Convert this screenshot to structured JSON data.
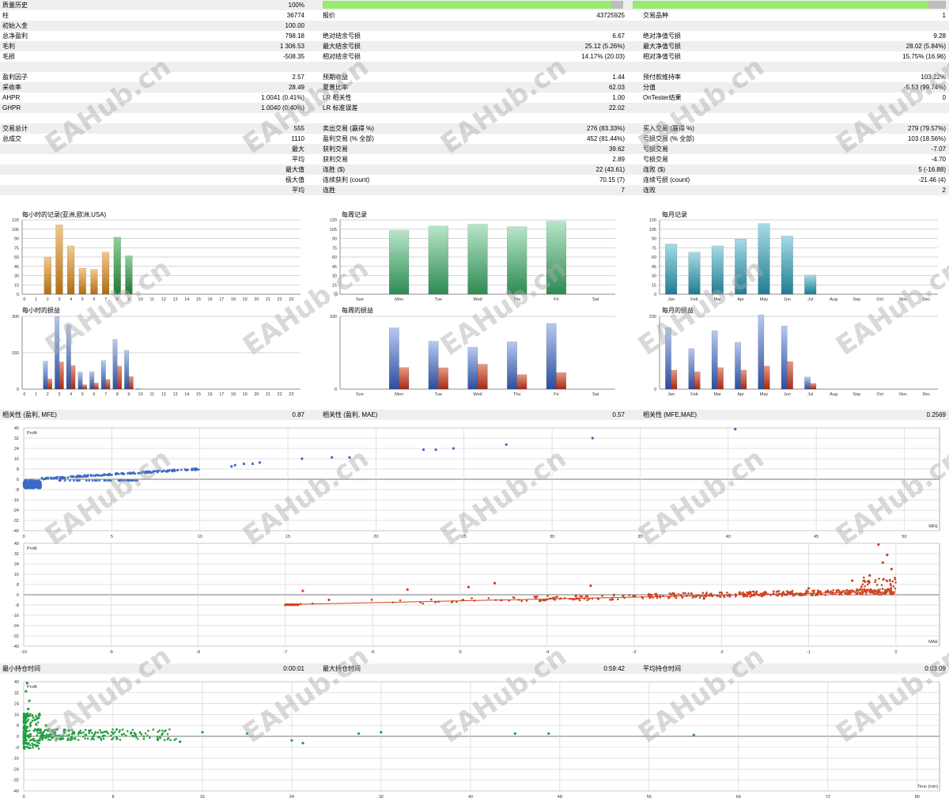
{
  "stats": {
    "history_quality": {
      "label": "质量历史",
      "value": "100%",
      "percent": 100
    },
    "bars": {
      "label": "柱",
      "value": "36774"
    },
    "ticks": {
      "label": "报价",
      "value": "43725925"
    },
    "symbols": {
      "label": "交易品种",
      "value": "1"
    },
    "initial_deposit": {
      "label": "初始入金",
      "value": "100.00"
    },
    "net_profit": {
      "label": "总净盈利",
      "value": "798.18"
    },
    "balance_dd_abs": {
      "label": "绝对结余亏损",
      "value": "6.67"
    },
    "equity_dd_abs": {
      "label": "绝对净值亏损",
      "value": "9.28"
    },
    "gross_profit": {
      "label": "毛利",
      "value": "1 306.53"
    },
    "balance_dd_max": {
      "label": "最大结余亏损",
      "value": "25.12 (5.26%)"
    },
    "equity_dd_max": {
      "label": "最大净值亏损",
      "value": "28.02 (5.84%)"
    },
    "gross_loss": {
      "label": "毛损",
      "value": "-508.35"
    },
    "balance_dd_rel": {
      "label": "相对结余亏损",
      "value": "14.17% (20.03)"
    },
    "equity_dd_rel": {
      "label": "相对净值亏损",
      "value": "15.75% (16.96)"
    },
    "profit_factor": {
      "label": "盈利因子",
      "value": "2.57"
    },
    "expected_payoff": {
      "label": "预期收益",
      "value": "1.44"
    },
    "margin_level": {
      "label": "预付款维持率",
      "value": "103.22%"
    },
    "recovery_factor": {
      "label": "采收率",
      "value": "28.49"
    },
    "sharpe_ratio": {
      "label": "夏普比率",
      "value": "62.03"
    },
    "z_score": {
      "label": "分值",
      "value": "-5.53 (99.74%)"
    },
    "ahpr": {
      "label": "AHPR",
      "value": "1.0041 (0.41%)"
    },
    "lr_correlation": {
      "label": "LR 相关性",
      "value": "1.00"
    },
    "ontester_result": {
      "label": "OnTester结果",
      "value": "0"
    },
    "ghpr": {
      "label": "GHPR",
      "value": "1.0040 (0.40%)"
    },
    "lr_std_error": {
      "label": "LR 标准误差",
      "value": "22.02"
    },
    "total_trades": {
      "label": "交易总计",
      "value": "555"
    },
    "short_trades": {
      "label": "卖出交易 (赢得 %)",
      "value": "276 (83.33%)"
    },
    "long_trades": {
      "label": "买入交易 (赢得 %)",
      "value": "279 (79.57%)"
    },
    "total_deals": {
      "label": "总成交",
      "value": "1110"
    },
    "profit_trades": {
      "label": "盈利交易 (% 全部)",
      "value": "452 (81.44%)"
    },
    "loss_trades": {
      "label": "亏损交易 (% 全部)",
      "value": "103 (18.56%)"
    },
    "largest_label": "最大",
    "largest_profit": {
      "label": "获利交易",
      "value": "39.62"
    },
    "largest_loss": {
      "label": "亏损交易",
      "value": "-7.07"
    },
    "average_label": "平均",
    "average_profit": {
      "label": "获利交易",
      "value": "2.89"
    },
    "average_loss": {
      "label": "亏损交易",
      "value": "-4.70"
    },
    "maximum_label": "最大值",
    "max_consec_wins": {
      "label": "连胜 ($)",
      "value": "22 (43.61)"
    },
    "max_consec_losses": {
      "label": "连败 ($)",
      "value": "5 (-16.88)"
    },
    "maximal_label": "极大值",
    "maximal_consec_profit": {
      "label": "连续获利 (count)",
      "value": "70.15 (7)"
    },
    "maximal_consec_loss": {
      "label": "连续亏损 (count)",
      "value": "-21.46 (4)"
    },
    "avg_label": "平均",
    "avg_consec_wins": {
      "label": "连胜",
      "value": "7"
    },
    "avg_consec_losses": {
      "label": "连败",
      "value": "2"
    },
    "corr_profit_mfe": {
      "label": "相关性 (盈利, MFE)",
      "value": "0.87"
    },
    "corr_profit_mae": {
      "label": "相关性 (盈利, MAE)",
      "value": "0.57"
    },
    "corr_mfe_mae": {
      "label": "相关性 (MFE,MAE)",
      "value": "0.2569"
    },
    "min_holding": {
      "label": "最小持仓时间",
      "value": "0:00:01"
    },
    "max_holding": {
      "label": "最大持仓时间",
      "value": "0:59:42"
    },
    "avg_holding": {
      "label": "平均持仓时间",
      "value": "0:03:09"
    }
  },
  "watermark_text": "EAHub.cn",
  "chart_data": [
    {
      "id": "hourly_entries",
      "type": "bar",
      "title": "每小时的记录(亚洲,欧洲,USA)",
      "categories": [
        "0",
        "1",
        "2",
        "3",
        "4",
        "5",
        "6",
        "7",
        "8",
        "9",
        "10",
        "11",
        "12",
        "13",
        "14",
        "15",
        "16",
        "17",
        "18",
        "19",
        "20",
        "21",
        "22",
        "23"
      ],
      "values": [
        0,
        0,
        60,
        112,
        78,
        42,
        40,
        68,
        92,
        62,
        0,
        0,
        0,
        0,
        0,
        0,
        0,
        0,
        0,
        0,
        0,
        0,
        0,
        0
      ],
      "colors_by_session": {
        "asia": "#c8862a",
        "europe": "#2e8b3a"
      },
      "ylim": [
        0,
        120
      ],
      "yticks": [
        0,
        15,
        30,
        45,
        60,
        75,
        90,
        105,
        120
      ]
    },
    {
      "id": "weekly_entries",
      "type": "bar",
      "title": "每周记录",
      "categories": [
        "Sun",
        "Mon",
        "Tue",
        "Wed",
        "Thu",
        "Fri",
        "Sat"
      ],
      "values": [
        0,
        103,
        110,
        113,
        109,
        118,
        0
      ],
      "color": "#3c9a60",
      "ylim": [
        0,
        120
      ],
      "yticks": [
        0,
        15,
        30,
        45,
        60,
        75,
        90,
        105,
        120
      ]
    },
    {
      "id": "monthly_entries",
      "type": "bar",
      "title": "每月记录",
      "categories": [
        "Jan",
        "Feb",
        "Mar",
        "Apr",
        "May",
        "Jun",
        "Jul",
        "Aug",
        "Sep",
        "Oct",
        "Nov",
        "Dec"
      ],
      "values": [
        81,
        68,
        78,
        89,
        114,
        94,
        31,
        0,
        0,
        0,
        0,
        0
      ],
      "color": "#2a8fa5",
      "ylim": [
        0,
        120
      ],
      "yticks": [
        0,
        15,
        30,
        45,
        60,
        75,
        90,
        105,
        120
      ]
    },
    {
      "id": "hourly_pl",
      "type": "bar",
      "title": "每小时的损益",
      "categories": [
        "0",
        "1",
        "2",
        "3",
        "4",
        "5",
        "6",
        "7",
        "8",
        "9",
        "10",
        "11",
        "12",
        "13",
        "14",
        "15",
        "16",
        "17",
        "18",
        "19",
        "20",
        "21",
        "22",
        "23"
      ],
      "series": [
        {
          "values": [
            0,
            0,
            115,
            300,
            265,
            70,
            72,
            118,
            205,
            160,
            2,
            0,
            0,
            0,
            0,
            0,
            0,
            0,
            0,
            0,
            0,
            0,
            0,
            0
          ],
          "color": "#3a5fb0"
        },
        {
          "values": [
            0,
            0,
            42,
            112,
            97,
            18,
            25,
            40,
            95,
            52,
            0,
            0,
            0,
            0,
            0,
            0,
            0,
            0,
            0,
            0,
            0,
            0,
            0,
            0
          ],
          "color": "#c0392b"
        }
      ],
      "ylim": [
        0,
        300
      ],
      "yticks": [
        0,
        150,
        300
      ]
    },
    {
      "id": "weekly_pl",
      "type": "bar",
      "title": "每周的损益",
      "categories": [
        "Sun",
        "Mon",
        "Tue",
        "Wed",
        "Thu",
        "Fri",
        "Sat"
      ],
      "series": [
        {
          "values": [
            0,
            278,
            217,
            190,
            215,
            298,
            0
          ],
          "color": "#3a5fb0"
        },
        {
          "values": [
            0,
            98,
            97,
            113,
            66,
            75,
            0
          ],
          "color": "#c0392b"
        }
      ],
      "ylim": [
        0,
        330
      ],
      "yticks": [
        0,
        330
      ]
    },
    {
      "id": "monthly_pl",
      "type": "bar",
      "title": "每月的损益",
      "categories": [
        "Jan",
        "Feb",
        "Mar",
        "Apr",
        "May",
        "Jun",
        "Jul",
        "Aug",
        "Sep",
        "Oct",
        "Nov",
        "Dec"
      ],
      "series": [
        {
          "values": [
            195,
            128,
            185,
            148,
            235,
            200,
            38,
            0,
            0,
            0,
            0,
            0
          ],
          "color": "#3a5fb0"
        },
        {
          "values": [
            60,
            55,
            68,
            60,
            73,
            87,
            18,
            0,
            0,
            0,
            0,
            0
          ],
          "color": "#c0392b"
        }
      ],
      "ylim": [
        0,
        230
      ],
      "yticks": [
        0,
        230
      ]
    },
    {
      "id": "scatter_mfe",
      "type": "scatter",
      "xlabel": "MFE",
      "ylabel": "Profit",
      "xlim": [
        0,
        52
      ],
      "ylim": [
        -40,
        40
      ],
      "xticks": [
        0,
        5,
        10,
        15,
        20,
        25,
        30,
        35,
        40,
        45,
        50
      ],
      "yticks": [
        -40,
        -32,
        -24,
        -16,
        -8,
        0,
        8,
        16,
        24,
        32,
        40
      ],
      "color": "#3a6bc4",
      "points": [
        [
          15.8,
          16
        ],
        [
          17.5,
          17
        ],
        [
          18.5,
          17
        ],
        [
          22.7,
          23
        ],
        [
          23.4,
          23
        ],
        [
          24.4,
          24
        ],
        [
          27.4,
          27
        ],
        [
          32.3,
          32
        ],
        [
          40.4,
          39
        ],
        [
          12.0,
          11
        ],
        [
          12.5,
          12
        ],
        [
          13.0,
          12
        ],
        [
          13.4,
          13
        ],
        [
          11.8,
          10
        ]
      ]
    },
    {
      "id": "scatter_mae",
      "type": "scatter",
      "xlabel": "MAE",
      "ylabel": "Profit",
      "xlim": [
        -10,
        0.5
      ],
      "ylim": [
        -40,
        40
      ],
      "xticks": [
        -10,
        -9,
        -8,
        -7,
        -6,
        -5,
        -4,
        -3,
        -2,
        -1,
        0
      ],
      "yticks": [
        -40,
        -32,
        -24,
        -16,
        -8,
        0,
        8,
        16,
        24,
        32,
        40
      ],
      "color": "#d2421e",
      "trend": [
        [
          -6.9,
          -7.5
        ],
        [
          0,
          2.5
        ]
      ],
      "points": [
        [
          -7.0,
          -8
        ],
        [
          -6.8,
          3
        ],
        [
          -6.5,
          -4
        ],
        [
          -5.6,
          4
        ],
        [
          -4.9,
          6
        ],
        [
          -4.6,
          9
        ],
        [
          -3.5,
          7
        ],
        [
          -2.2,
          -3
        ],
        [
          -0.2,
          39
        ],
        [
          -0.1,
          31
        ],
        [
          -0.15,
          25
        ],
        [
          -0.05,
          20
        ],
        [
          -0.3,
          15
        ],
        [
          -0.5,
          11
        ],
        [
          -1.0,
          5
        ],
        [
          -1.5,
          2
        ]
      ]
    },
    {
      "id": "scatter_holding",
      "type": "scatter",
      "xlabel": "Time (min)",
      "ylabel": "Profit",
      "xlim": [
        0,
        82
      ],
      "ylim": [
        -40,
        40
      ],
      "xticks": [
        0,
        8,
        16,
        24,
        32,
        40,
        48,
        56,
        64,
        72,
        80
      ],
      "yticks": [
        -40,
        -32,
        -24,
        -16,
        -8,
        0,
        8,
        16,
        24,
        32,
        40
      ],
      "color": "#1f9e3f",
      "points": [
        [
          0.3,
          39
        ],
        [
          0.2,
          33
        ],
        [
          0.5,
          26
        ],
        [
          0.4,
          20
        ],
        [
          1.0,
          12
        ],
        [
          2.0,
          8
        ],
        [
          3.0,
          5
        ],
        [
          5.0,
          3
        ],
        [
          8.0,
          2
        ],
        [
          10.0,
          1
        ],
        [
          12.0,
          -2
        ],
        [
          14.0,
          -4
        ],
        [
          16.0,
          3
        ],
        [
          20.0,
          2
        ],
        [
          24.0,
          -3
        ],
        [
          25.0,
          -5
        ],
        [
          30.0,
          2
        ],
        [
          32.0,
          3
        ],
        [
          44.0,
          2
        ],
        [
          47.0,
          2
        ],
        [
          60.0,
          1
        ]
      ]
    }
  ]
}
